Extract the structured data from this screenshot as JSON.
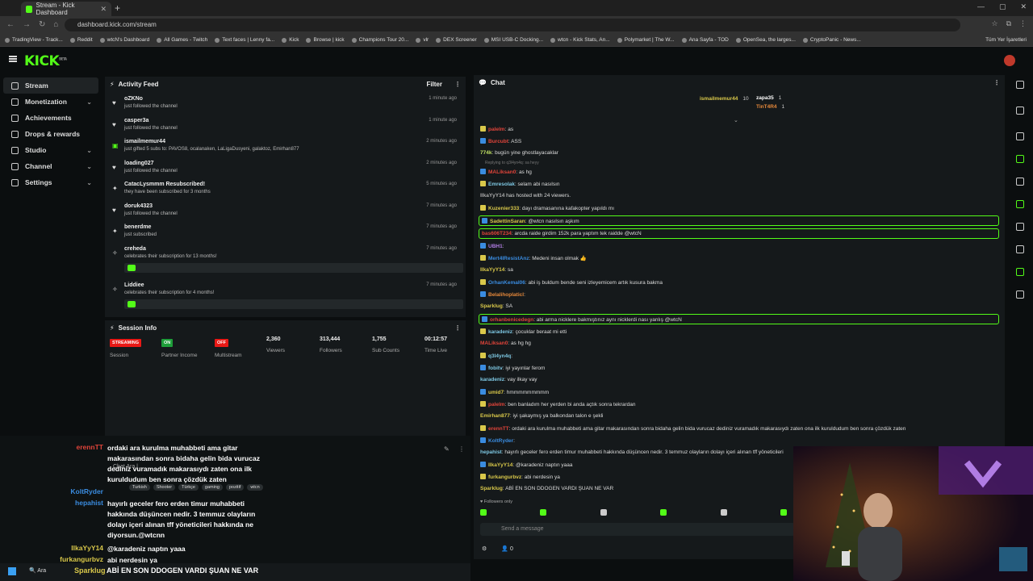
{
  "browser": {
    "tab_title": "Stream - Kick Dashboard",
    "url": "dashboard.kick.com/stream",
    "bookmarks": [
      "TradingView - Track...",
      "Reddit",
      "wtcN's Dashboard",
      "All Games - Twitch",
      "Text faces | Lenny fa...",
      "Kick",
      "Browse | kick",
      "Champions Tour 20...",
      "vlr",
      "DEX Screener",
      "MSI USB-C Docking...",
      "wtcn - Kick Stats, An...",
      "Polymarket | The W...",
      "Ana Sayfa - TOD",
      "OpenSea, the larges...",
      "CryptoPanic - News..."
    ],
    "all_bookmarks": "Tüm Yer İşaretleri"
  },
  "logo": "KICK",
  "logo_beta": "BETA",
  "sidebar": {
    "items": [
      {
        "label": "Stream",
        "icon": "video-icon",
        "expand": false
      },
      {
        "label": "Monetization",
        "icon": "dollar-icon",
        "expand": true
      },
      {
        "label": "Achievements",
        "icon": "trophy-icon",
        "expand": false
      },
      {
        "label": "Drops & rewards",
        "icon": "gift-icon",
        "expand": false
      },
      {
        "label": "Studio",
        "icon": "studio-icon",
        "expand": true
      },
      {
        "label": "Channel",
        "icon": "channel-icon",
        "expand": true
      },
      {
        "label": "Settings",
        "icon": "gear-icon",
        "expand": true
      }
    ]
  },
  "activity": {
    "title": "Activity Feed",
    "filter": "Filter",
    "items": [
      {
        "name": "oZKNo",
        "desc": "just followed the channel",
        "time": "1 minute ago",
        "icon": "♥"
      },
      {
        "name": "casper3a",
        "desc": "just followed the channel",
        "time": "1 minute ago",
        "icon": "♥"
      },
      {
        "name": "ismailmemur44",
        "desc": "just gifted 5 subs to: PAVOS8, ocalanaken, LaLigaDusyeni, galaktoz, Emirhan877",
        "time": "2 minutes ago",
        "icon": "▣"
      },
      {
        "name": "loading027",
        "desc": "just followed the channel",
        "time": "2 minutes ago",
        "icon": "♥"
      },
      {
        "name": "CatacLysmmm Resubscribed!",
        "desc": "they have been subscribed for 3 months",
        "time": "5 minutes ago",
        "icon": "✦"
      },
      {
        "name": "doruk4323",
        "desc": "just followed the channel",
        "time": "7 minutes ago",
        "icon": "♥"
      },
      {
        "name": "benerdme",
        "desc": "just subscribed",
        "time": "7 minutes ago",
        "icon": "✦"
      },
      {
        "name": "creheda",
        "desc": "celebrates their subscription for 13 months!",
        "time": "7 minutes ago",
        "icon": "✧"
      },
      {
        "name": "Liddiee",
        "desc": "celebrates their subscription for 4 months!",
        "time": "7 minutes ago",
        "icon": "✧"
      }
    ]
  },
  "session": {
    "title": "Session Info",
    "badges": [
      {
        "text": "STREAMING",
        "label": "Session",
        "color": "#e91916"
      },
      {
        "text": "ON",
        "label": "Partner Income",
        "color": "#1e9e3a"
      },
      {
        "text": "OFF",
        "label": "Multistream",
        "color": "#e91916"
      }
    ],
    "stats": [
      {
        "value": "2,360",
        "label": "Viewers"
      },
      {
        "value": "313,444",
        "label": "Followers"
      },
      {
        "value": "1,755",
        "label": "Sub Counts"
      },
      {
        "value": "00:12:57",
        "label": "Time Live"
      }
    ]
  },
  "overlay": {
    "stream_title_partial": "Chat Ara | ...",
    "tags": [
      "Turkish",
      "Shooter",
      "Türkçe",
      "gaming",
      "pozitif",
      "wtcn"
    ],
    "messages": [
      {
        "user": "erennTT",
        "color": "#e0443a",
        "text": "ordaki ara kurulma muhabbeti ama gitar makarasından sonra bidaha gelin bida vurucaz dediniz vuramadık makarasıydı zaten ona ilk kuruldudum ben sonra çözdük zaten"
      },
      {
        "user": "KoltRyder",
        "color": "#3a8ce0",
        "text": ""
      },
      {
        "user": "hepahist",
        "color": "#3a8ce0",
        "text": "hayırlı geceler fero erden timur muhabbeti hakkında düşüncen nedir. 3 temmuz olayların dolayı içeri alınan tff yöneticileri hakkında ne diyorsun.@wtcnn"
      },
      {
        "user": "IlkaYyY14",
        "color": "#d9c84a",
        "text": "@karadeniz naptın yaaa"
      },
      {
        "user": "furkangurbvz",
        "color": "#d9c84a",
        "text": "abi nerdesin ya"
      },
      {
        "user": "Sparklug",
        "color": "#d9c84a",
        "text": "ABİ EN SON DDOGEN VARDI ŞUAN NE VAR"
      }
    ]
  },
  "chat": {
    "title": "Chat",
    "pinned": [
      {
        "user": "ismailmemur44",
        "count": "10",
        "color": "#d9c84a"
      },
      {
        "user": "zapa35",
        "count": "1",
        "color": "#ffffff"
      },
      {
        "user": "TinT4R4",
        "count": "1",
        "color": "#e6883a"
      }
    ],
    "reply_hint": "Replying to q3l4yn4q: sa heyy",
    "messages": [
      {
        "user": "palelm",
        "color": "#e0443a",
        "text": ": as",
        "hl": false
      },
      {
        "user": "Burcubt",
        "color": "#e0443a",
        "text": ": ASS",
        "hl": false
      },
      {
        "user": "774k",
        "color": "#bfe063",
        "text": ": bugün yine ghostlayacaklar",
        "hl": false
      },
      {
        "user": "MALiksan0",
        "color": "#e0443a",
        "text": ": as hg",
        "hl": false
      },
      {
        "user": "Emresolak",
        "color": "#7ec8e3",
        "text": ": selam abi nasılsın",
        "hl": false
      },
      {
        "user": "IlkaYyY14",
        "color": "#aaaaaa",
        "text": " has hosted with 24 viewers.",
        "hl": false
      },
      {
        "user": "Kuzenier333",
        "color": "#d9c84a",
        "text": ": dayı dramasanına kafakopter yapıldı mı",
        "hl": false
      },
      {
        "user": "SadettinSaran",
        "color": "#d9c84a",
        "text": ": @wtcn nasılsın aşkım",
        "hl": true
      },
      {
        "user": "bas606T234",
        "color": "#e0443a",
        "text": ": arcda raide girdim 152k para yaptım tek raidde @wtcN",
        "hl": true
      },
      {
        "user": "UBH1",
        "color": "#b07ce3",
        "text": ":",
        "hl": false
      },
      {
        "user": "Mert4lResistAnz",
        "color": "#3a8ce0",
        "text": ": Medeni insan olmak 👍",
        "hl": false
      },
      {
        "user": "IlkaYyY14",
        "color": "#d9c84a",
        "text": ": sa",
        "hl": false
      },
      {
        "user": "OrhanKemal06",
        "color": "#3a8ce0",
        "text": ": abi iş buldum bende seni izleyemicem artık kusura bakma",
        "hl": false
      },
      {
        "user": "Belalihoplaticl",
        "color": "#e6883a",
        "text": ":",
        "hl": false
      },
      {
        "user": "Sparklug",
        "color": "#d9c84a",
        "text": ": SA",
        "hl": false
      },
      {
        "user": "orhanbenicedegn",
        "color": "#e0443a",
        "text": ": abi arma nicklere bakmıştınız aynı nicklerdi nası yanlış @wtcN",
        "hl": true
      },
      {
        "user": "karadeniz",
        "color": "#7ec8e3",
        "text": ": çocuklar beraat mi etti",
        "hl": false
      },
      {
        "user": "MALiksan0",
        "color": "#e0443a",
        "text": ": as hg hg",
        "hl": false
      },
      {
        "user": "q3l4yn4q",
        "color": "#7ec8e3",
        "text": ":",
        "hl": false
      },
      {
        "user": "fobitv",
        "color": "#7ec8e3",
        "text": ": iyi yayınlar ferom",
        "hl": false
      },
      {
        "user": "karadeniz",
        "color": "#7ec8e3",
        "text": ": vay ilkay vay",
        "hl": false
      },
      {
        "user": "umid7",
        "color": "#d9c84a",
        "text": ": hmmmmmmmmm",
        "hl": false
      },
      {
        "user": "palelm",
        "color": "#e0443a",
        "text": ": ben banladım her yerden bi anda açtık sonra tekrardan",
        "hl": false
      },
      {
        "user": "Emirhan877",
        "color": "#d9c84a",
        "text": ": iyi şakaymış ya balkondan talon e şekli",
        "hl": false
      },
      {
        "user": "erennTT",
        "color": "#e0443a",
        "text": ": ordaki ara kurulma muhabbeti ama gitar makarasından sonra bidaha gelin bida vurucaz dediniz vuramadık makarasıydı zaten ona ilk kuruldudum ben sonra çözdük zaten",
        "hl": false
      },
      {
        "user": "KoltRyder",
        "color": "#3a8ce0",
        "text": ":",
        "hl": false
      },
      {
        "user": "hepahist",
        "color": "#7ec8e3",
        "text": ": hayırlı geceler fero erden timur muhabbeti hakkında düşüncen nedir. 3 temmuz olayların dolayı içeri alınan tff yöneticileri",
        "hl": false
      },
      {
        "user": "IlkaYyY14",
        "color": "#d9c84a",
        "text": ": @karadeniz naptın yaaa",
        "hl": false
      },
      {
        "user": "furkangurbvz",
        "color": "#d9c84a",
        "text": ": abi nerdesin ya",
        "hl": false
      },
      {
        "user": "Sparklug",
        "color": "#d9c84a",
        "text": ": ABİ EN SON DDOGEN VARDI ŞUAN NE VAR",
        "hl": false
      }
    ],
    "followers_only": "Followers only",
    "input_placeholder": "Send a message",
    "footer_count": "0"
  },
  "taskbar": {
    "search": "Ara"
  },
  "colors": {
    "accent": "#53fc18",
    "panel": "#15191b",
    "bg": "#0b0e0f"
  }
}
